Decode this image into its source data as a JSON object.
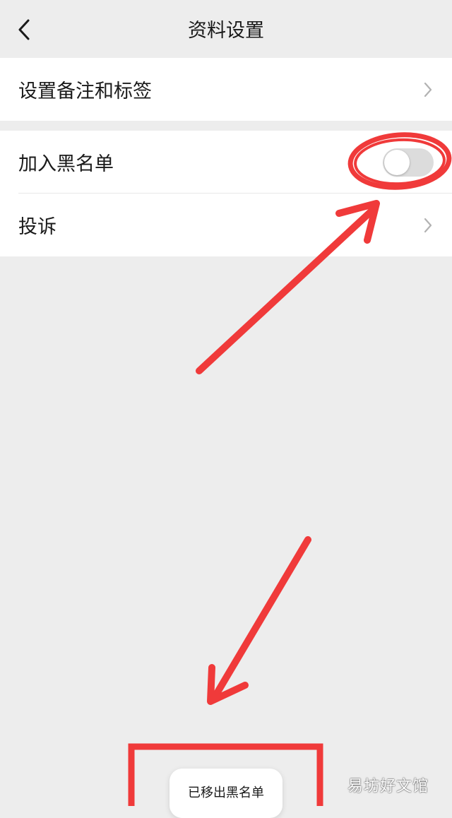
{
  "nav": {
    "title": "资料设置",
    "back_icon": "chevron-left-icon"
  },
  "group1": {
    "items": [
      {
        "label": "设置备注和标签",
        "icon": "chevron-right-icon"
      }
    ]
  },
  "group2": {
    "items": [
      {
        "label": "加入黑名单",
        "toggle_on": false
      },
      {
        "label": "投诉",
        "icon": "chevron-right-icon"
      }
    ]
  },
  "toast": {
    "text": "已移出黑名单"
  },
  "watermark": {
    "text": "易坊好文馆"
  },
  "colors": {
    "background": "#ededed",
    "card": "#ffffff",
    "annotation_red": "#f03a3a",
    "toggle_off": "#dcdcdc"
  }
}
